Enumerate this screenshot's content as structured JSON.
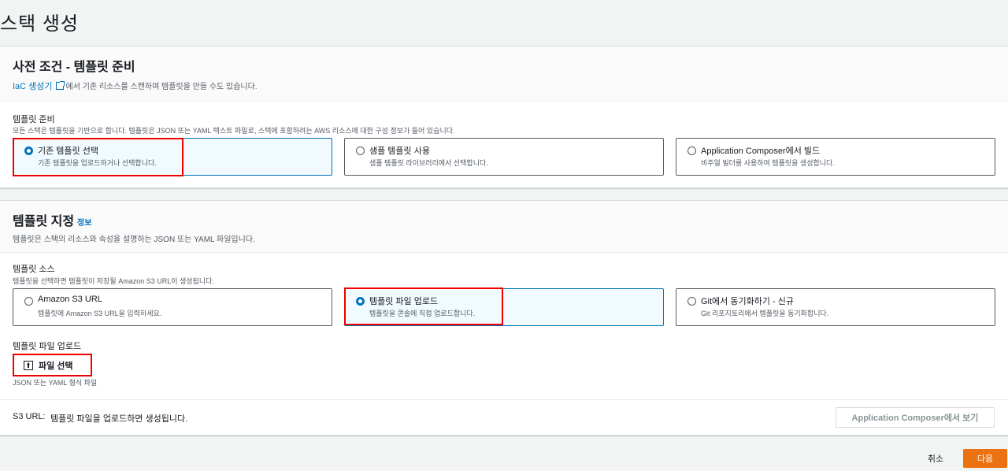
{
  "page": {
    "title": "스택 생성"
  },
  "prereq": {
    "title": "사전 조건 - 템플릿 준비",
    "link": "IaC 생성기",
    "desc_after_link": "에서 기존 리소스를 스캔하여 템플릿을 만들 수도 있습니다.",
    "field_label": "템플릿 준비",
    "field_desc": "모든 스택은 템플릿을 기반으로 합니다. 템플릿은 JSON 또는 YAML 텍스트 파일로, 스택에 포함하려는 AWS 리소스에 대한 구성 정보가 들어 있습니다.",
    "options": [
      {
        "title": "기존 템플릿 선택",
        "desc": "기존 템플릿을 업로드하거나 선택합니다."
      },
      {
        "title": "샘플 템플릿 사용",
        "desc": "샘플 템플릿 라이브러리에서 선택합니다."
      },
      {
        "title": "Application Composer에서 빌드",
        "desc": "비주얼 빌더를 사용하여 템플릿을 생성합니다."
      }
    ],
    "selected_index": 0
  },
  "specify": {
    "title": "템플릿 지정",
    "info": "정보",
    "desc": "템플릿은 스택의 리소스와 속성을 설명하는 JSON 또는 YAML 파일입니다.",
    "source_label": "템플릿 소스",
    "source_desc": "템플릿을 선택하면 템플릿이 저장될 Amazon S3 URL이 생성됩니다.",
    "options": [
      {
        "title": "Amazon S3 URL",
        "desc": "템플릿에 Amazon S3 URL을 입력하세요."
      },
      {
        "title": "템플릿 파일 업로드",
        "desc": "템플릿을 콘솔에 직접 업로드합니다."
      },
      {
        "title": "Git에서 동기화하기 - 신규",
        "desc": "Git 리포지토리에서 템플릿을 동기화합니다."
      }
    ],
    "selected_index": 1,
    "upload_label": "템플릿 파일 업로드",
    "upload_button": "파일 선택",
    "upload_hint": "JSON 또는 YAML 형식 파일",
    "s3_label": "S3 URL:",
    "s3_value": "템플릿 파일을 업로드하면 생성됩니다.",
    "view_button": "Application Composer에서 보기"
  },
  "footer": {
    "cancel": "취소",
    "next": "다음"
  }
}
